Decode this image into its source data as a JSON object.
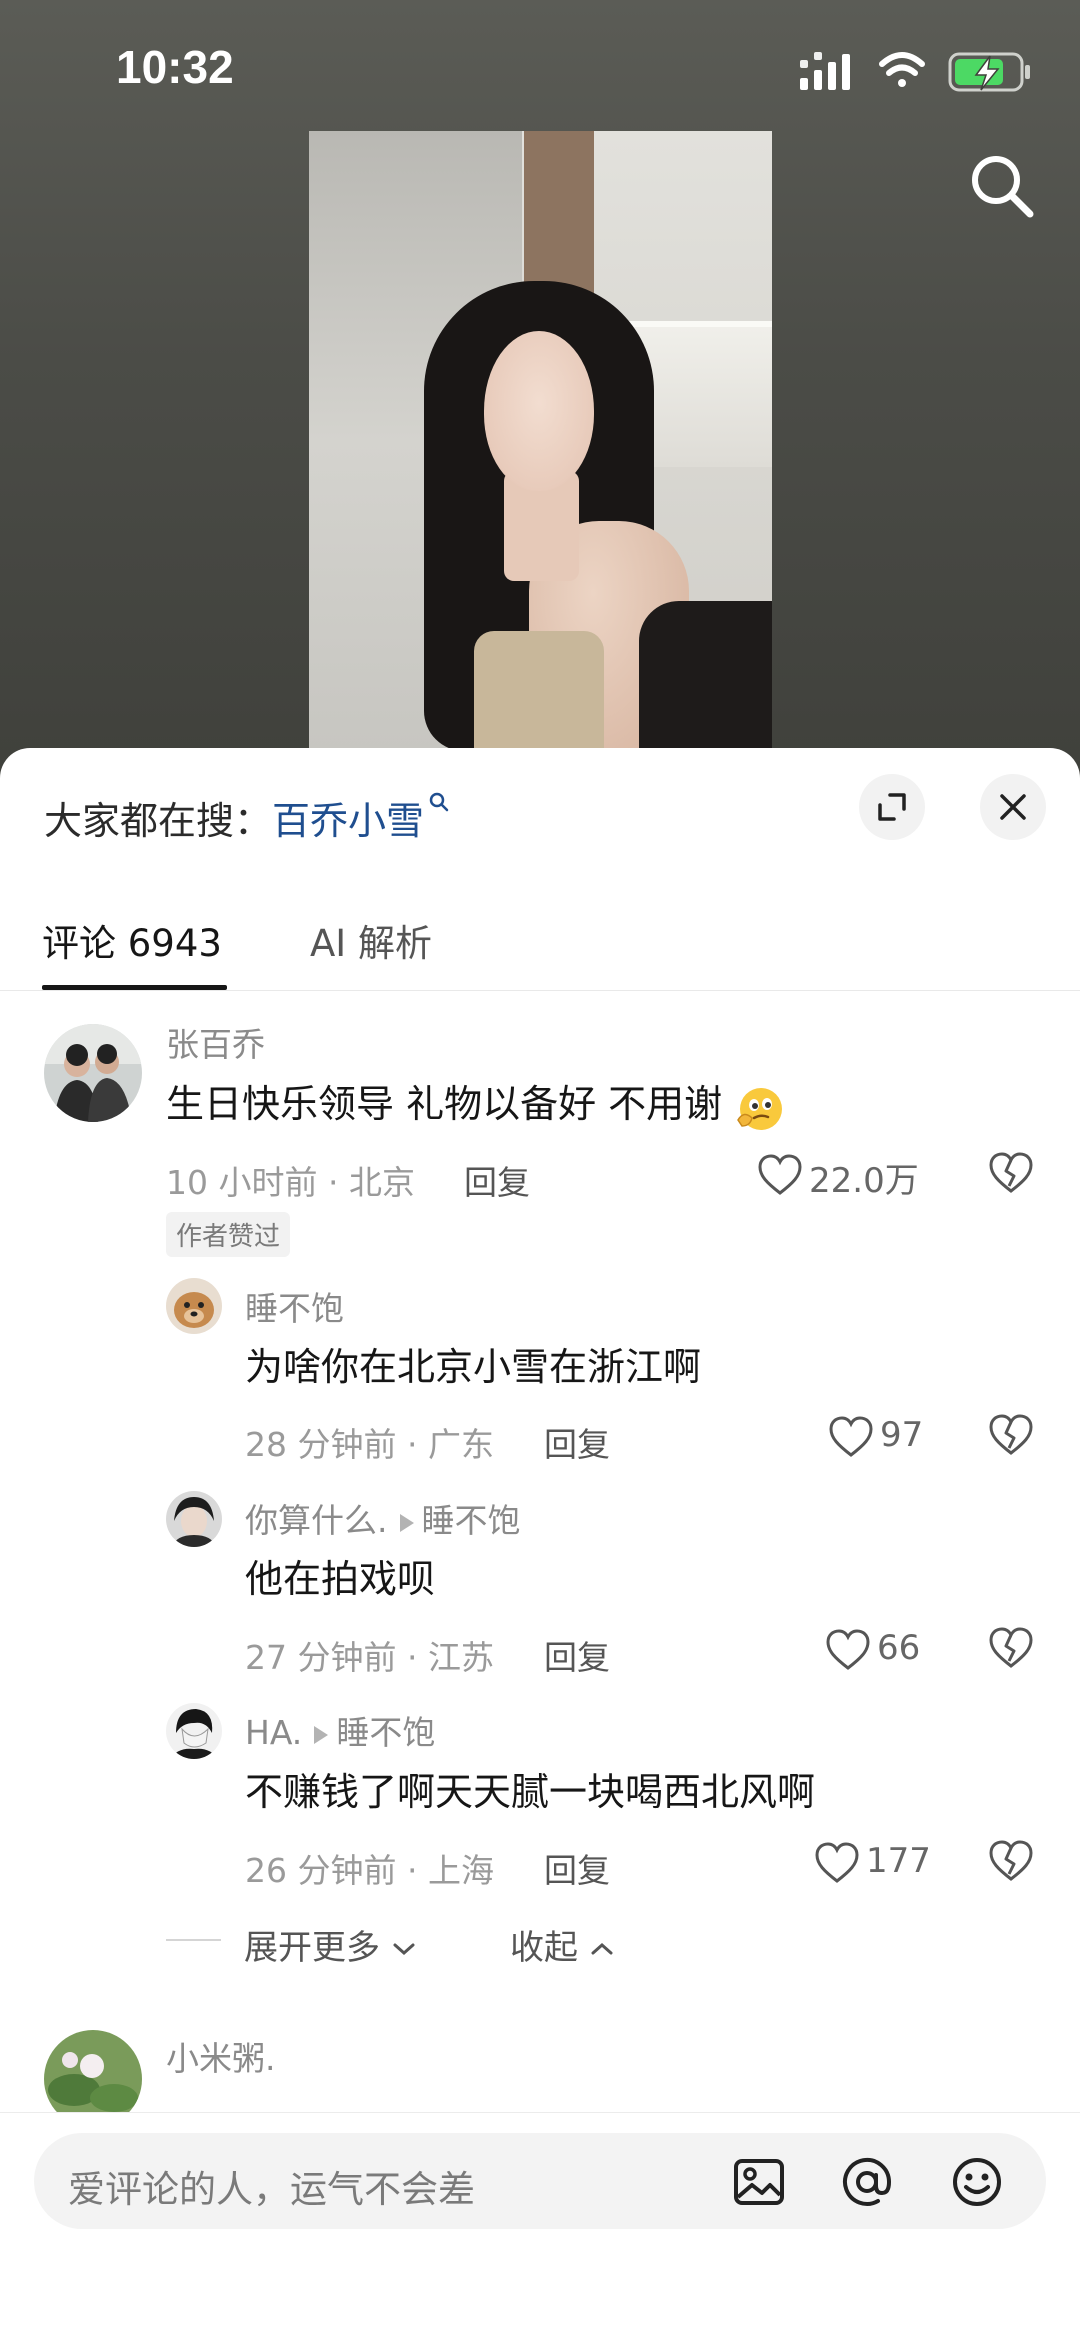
{
  "status_bar": {
    "time": "10:32"
  },
  "hot_search": {
    "prefix": "大家都在搜：",
    "term": "百乔小雪"
  },
  "tabs": {
    "comments": "评论 6943",
    "ai": "AI 解析"
  },
  "comments": [
    {
      "author": "张百乔",
      "text": "生日快乐领导 礼物以备好 不用谢",
      "meta": "10 小时前 · 北京",
      "reply_label": "回复",
      "likes": "22.0万",
      "badge": "作者赞过"
    }
  ],
  "replies": [
    {
      "author": "睡不饱",
      "reply_to": "",
      "text": "为啥你在北京小雪在浙江啊",
      "meta": "28 分钟前 · 广东",
      "reply_label": "回复",
      "likes": "97"
    },
    {
      "author": "你算什么.",
      "reply_to": "睡不饱",
      "text": "他在拍戏呗",
      "meta": "27 分钟前 · 江苏",
      "reply_label": "回复",
      "likes": "66"
    },
    {
      "author": "HA.",
      "reply_to": "睡不饱",
      "text": "不赚钱了啊天天腻一块喝西北风啊",
      "meta": "26 分钟前 · 上海",
      "reply_label": "回复",
      "likes": "177"
    }
  ],
  "thread_controls": {
    "expand_more": "展开更多",
    "collapse": "收起"
  },
  "next_comment": {
    "author": "小米粥."
  },
  "input": {
    "placeholder": "爱评论的人，运气不会差"
  },
  "colors": {
    "accent_link": "#1f4e8f",
    "sheet_bg": "#ffffff",
    "video_bg": "#4a4b46",
    "battery_green": "#4cd964"
  }
}
